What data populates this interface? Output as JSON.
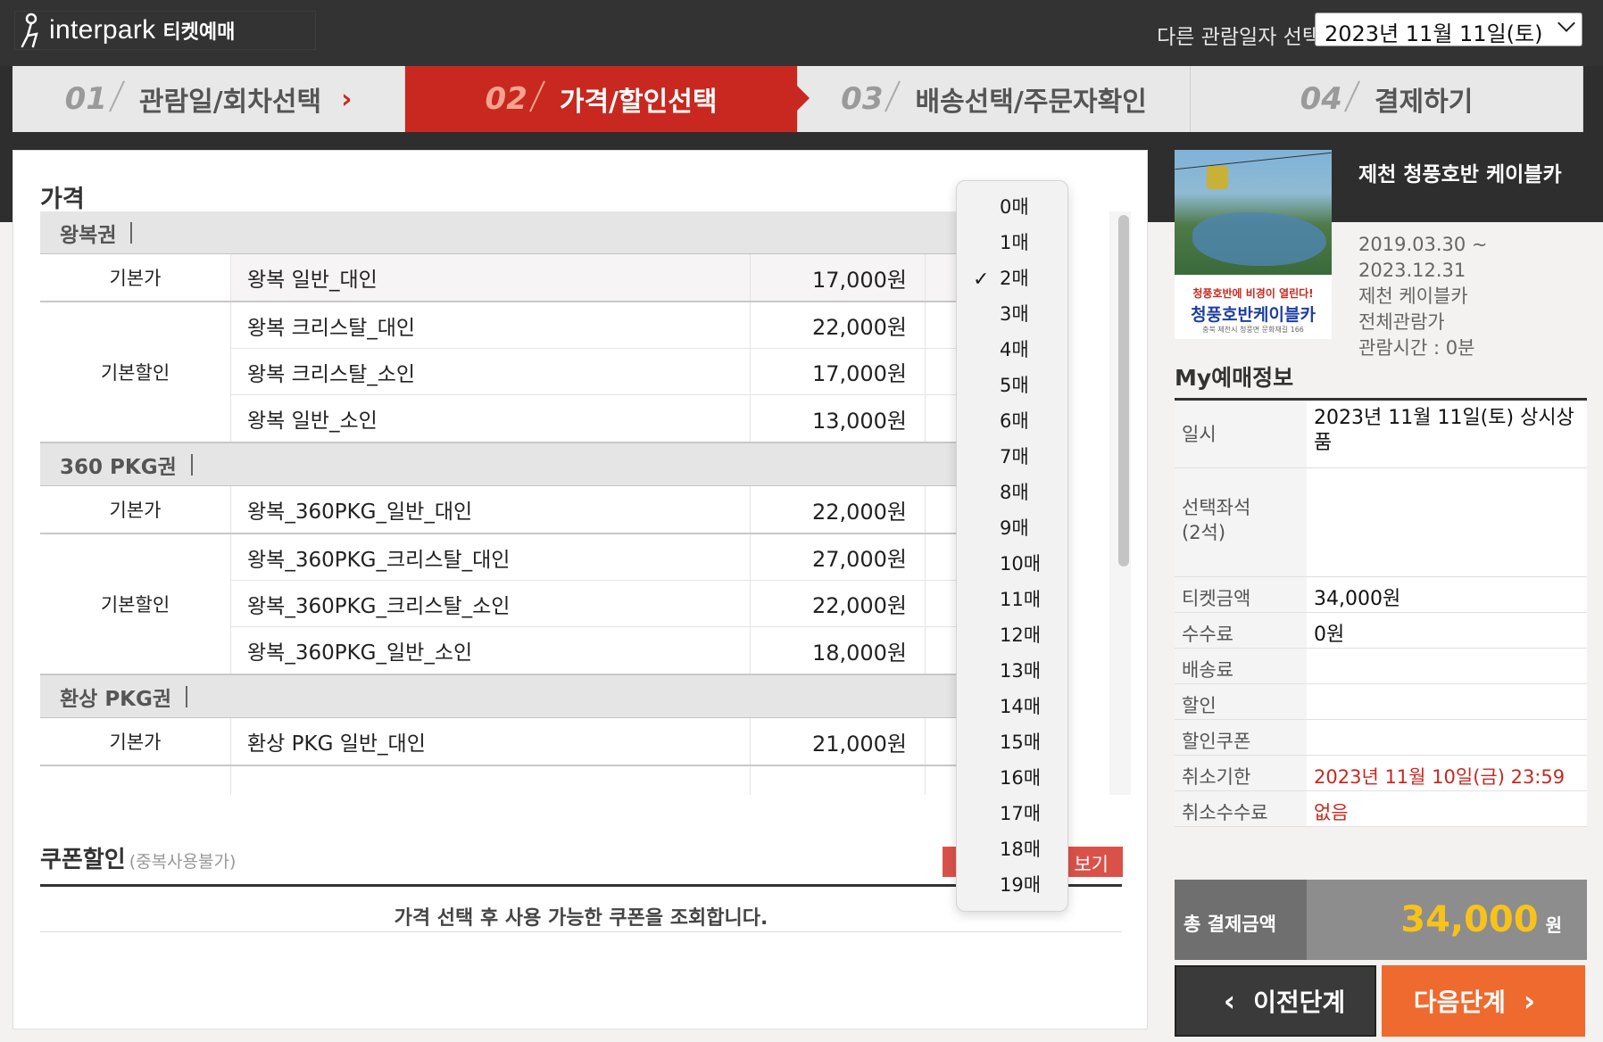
{
  "header": {
    "logo_text": "interpark",
    "logo_sub": "티켓예매",
    "other_date_label": "다른 관람일자 선택",
    "selected_date": "2023년 11월 11일(토)"
  },
  "steps": [
    {
      "num": "01",
      "label": "관람일/회차선택"
    },
    {
      "num": "02",
      "label": "가격/할인선택"
    },
    {
      "num": "03",
      "label": "배송선택/주문자확인"
    },
    {
      "num": "04",
      "label": "결제하기"
    }
  ],
  "price_section": {
    "title": "가격",
    "groups": [
      {
        "name": "왕복권",
        "blocks": [
          {
            "category": "기본가",
            "rows": [
              {
                "name": "왕복 일반_대인",
                "price": "17,000원"
              }
            ]
          },
          {
            "category": "기본할인",
            "rows": [
              {
                "name": "왕복 크리스탈_대인",
                "price": "22,000원"
              },
              {
                "name": "왕복 크리스탈_소인",
                "price": "17,000원"
              },
              {
                "name": "왕복 일반_소인",
                "price": "13,000원"
              }
            ]
          }
        ]
      },
      {
        "name": "360 PKG권",
        "blocks": [
          {
            "category": "기본가",
            "rows": [
              {
                "name": "왕복_360PKG_일반_대인",
                "price": "22,000원"
              }
            ]
          },
          {
            "category": "기본할인",
            "rows": [
              {
                "name": "왕복_360PKG_크리스탈_대인",
                "price": "27,000원"
              },
              {
                "name": "왕복_360PKG_크리스탈_소인",
                "price": "22,000원"
              },
              {
                "name": "왕복_360PKG_일반_소인",
                "price": "18,000원"
              }
            ]
          }
        ]
      },
      {
        "name": "환상 PKG권",
        "blocks": [
          {
            "category": "기본가",
            "rows": [
              {
                "name": "환상 PKG 일반_대인",
                "price": "21,000원"
              }
            ]
          }
        ]
      }
    ]
  },
  "quantity_dropdown": {
    "selected": "2매",
    "options": [
      "0매",
      "1매",
      "2매",
      "3매",
      "4매",
      "5매",
      "6매",
      "7매",
      "8매",
      "9매",
      "10매",
      "11매",
      "12매",
      "13매",
      "14매",
      "15매",
      "16매",
      "17매",
      "18매",
      "19매"
    ]
  },
  "coupon": {
    "title": "쿠폰할인",
    "sub": "(중복사용불가)",
    "button_label": "보기",
    "note": "가격 선택 후 사용 가능한 쿠폰을 조회합니다."
  },
  "product": {
    "title": "제천 청풍호반 케이블카",
    "period_start": "2019.03.30 ~",
    "period_end": "2023.12.31",
    "venue": "제천 케이블카",
    "rating": "전체관람가",
    "runtime": "관람시간 : 0분",
    "poster_line1": "청풍호반에 비경이 열린다!",
    "poster_line2": "청풍호반케이블카",
    "poster_line3": "충북 제천시 청풍면 문화재길 166"
  },
  "my_booking": {
    "title": "My예매정보",
    "rows": [
      {
        "key": "일시",
        "value": "2023년 11월 11일(토) 상시상품"
      },
      {
        "key": "선택좌석\n(2석)",
        "value": ""
      },
      {
        "key": "티켓금액",
        "value": "34,000원"
      },
      {
        "key": "수수료",
        "value": "0원"
      },
      {
        "key": "배송료",
        "value": ""
      },
      {
        "key": "할인",
        "value": ""
      },
      {
        "key": "할인쿠폰",
        "value": ""
      },
      {
        "key": "취소기한",
        "value": "2023년 11월 10일(금) 23:59"
      },
      {
        "key": "취소수수료",
        "value": "없음"
      }
    ],
    "total_label": "총 결제금액",
    "total_amount": "34,000",
    "total_unit": "원"
  },
  "nav": {
    "prev_label": "이전단계",
    "next_label": "다음단계"
  },
  "colors": {
    "accent_red": "#c8281f",
    "next_orange": "#ef6a2e",
    "total_yellow": "#f7c21a"
  }
}
